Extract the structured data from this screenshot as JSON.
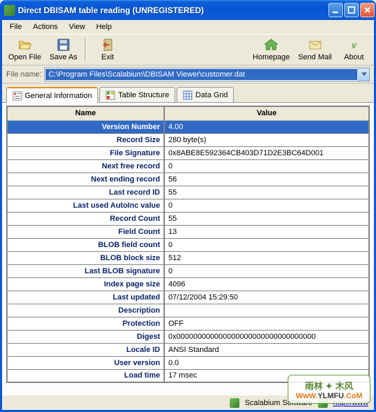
{
  "title": "Direct DBISAM table reading (UNREGISTERED)",
  "menu": [
    "File",
    "Actions",
    "View",
    "Help"
  ],
  "toolbar": {
    "open": "Open File",
    "save": "Save As",
    "exit": "Exit",
    "home": "Homepage",
    "mail": "Send Mail",
    "about": "About"
  },
  "filebar": {
    "label": "File name:",
    "value": "C:\\Program Files\\Scalabium\\DBISAM Viewer\\customer.dat"
  },
  "tabs": {
    "general": "General Information",
    "structure": "Table Structure",
    "grid": "Data Grid"
  },
  "headers": {
    "name": "Name",
    "value": "Value"
  },
  "rows": [
    {
      "n": "Version Number",
      "v": "4.00",
      "sel": true
    },
    {
      "n": "Record Size",
      "v": "280 byte(s)"
    },
    {
      "n": "File Signature",
      "v": "0x8ABE8E592364CB403D71D2E3BC64D001"
    },
    {
      "n": "Next free record",
      "v": "0"
    },
    {
      "n": "Next ending record",
      "v": "56"
    },
    {
      "n": "Last record ID",
      "v": "55"
    },
    {
      "n": "Last used AutoInc value",
      "v": "0"
    },
    {
      "n": "Record Count",
      "v": "55"
    },
    {
      "n": "Field Count",
      "v": "13"
    },
    {
      "n": "BLOB field count",
      "v": "0"
    },
    {
      "n": "BLOB block size",
      "v": "512"
    },
    {
      "n": "Last BLOB signature",
      "v": "0"
    },
    {
      "n": "Index page size",
      "v": "4096"
    },
    {
      "n": "Last updated",
      "v": "07/12/2004 15:29:50"
    },
    {
      "n": "Description",
      "v": ""
    },
    {
      "n": "Protection",
      "v": "OFF"
    },
    {
      "n": "Digest",
      "v": "0x000000000000000000000000000000000"
    },
    {
      "n": "Locale ID",
      "v": "ANSI Standard"
    },
    {
      "n": "User version",
      "v": "0.0"
    },
    {
      "n": "Load time",
      "v": "17 msec"
    }
  ],
  "status": {
    "company": "Scalabium Software",
    "link": "http://www"
  },
  "watermark": {
    "cn": "雨林 ✦ 木风",
    "url_left": "WwW.",
    "url_mid": "YLMFU",
    "url_right": ".CoM"
  }
}
